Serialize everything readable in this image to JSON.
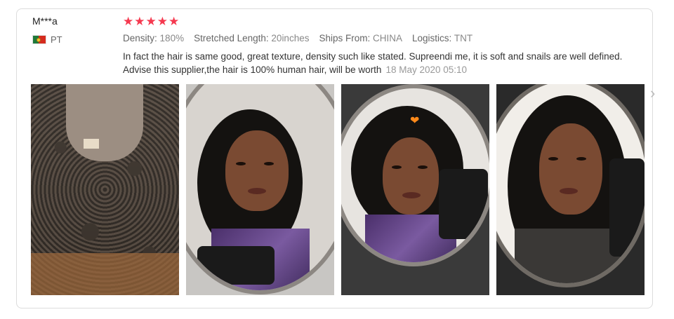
{
  "review": {
    "reviewer_name": "M***a",
    "country_code": "PT",
    "rating": 5,
    "stars": [
      "★",
      "★",
      "★",
      "★",
      "★"
    ],
    "specs": [
      {
        "label": "Density:",
        "value": "180%"
      },
      {
        "label": "Stretched Length:",
        "value": "20inches"
      },
      {
        "label": "Ships From:",
        "value": "CHINA"
      },
      {
        "label": "Logistics:",
        "value": "TNT"
      }
    ],
    "text": "In fact the hair is same good, great texture, density such like stated. Supreendi me, it is soft and snails are well defined. Advise this supplier,the hair is 100% human hair, will be worth",
    "date": "18 May 2020 05:10"
  },
  "icons": {
    "flag": "portugal-flag-icon",
    "star": "star-icon",
    "next": "chevron-right-icon",
    "heart": "heart-icon"
  },
  "colors": {
    "star": "#f5394f",
    "border": "#dcdcdc",
    "muted": "#888888"
  },
  "photos": [
    "wig-photo",
    "selfie-photo-1",
    "selfie-photo-2",
    "selfie-photo-3"
  ]
}
